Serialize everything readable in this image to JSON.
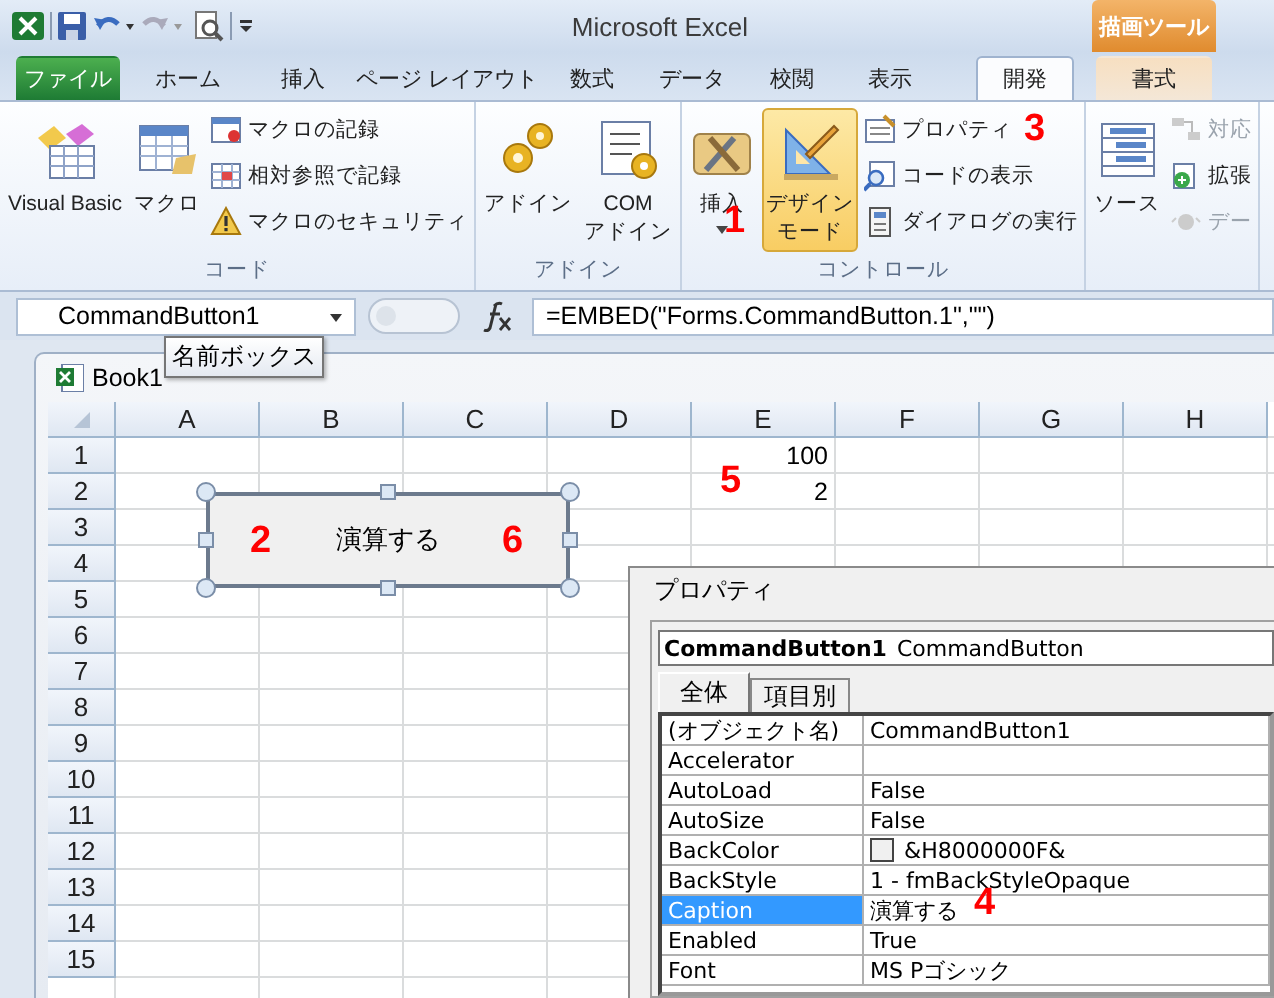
{
  "title_bar": {
    "title": "Microsoft Excel",
    "context_label": "描画ツール"
  },
  "ribbon_tabs": [
    {
      "label": "ファイル",
      "kind": "file",
      "selected": false
    },
    {
      "label": "ホーム",
      "kind": "normal",
      "selected": false
    },
    {
      "label": "挿入",
      "kind": "normal",
      "selected": false
    },
    {
      "label": "ページ レイアウト",
      "kind": "normal",
      "selected": false
    },
    {
      "label": "数式",
      "kind": "normal",
      "selected": false
    },
    {
      "label": "データ",
      "kind": "normal",
      "selected": false
    },
    {
      "label": "校閲",
      "kind": "normal",
      "selected": false
    },
    {
      "label": "表示",
      "kind": "normal",
      "selected": false
    },
    {
      "label": "開発",
      "kind": "normal",
      "selected": true
    },
    {
      "label": "書式",
      "kind": "context",
      "selected": false
    }
  ],
  "ribbon_groups": [
    {
      "label": "コード",
      "large": [
        {
          "lines": [
            "Visual Basic"
          ],
          "selected": false,
          "dropdown": false
        },
        {
          "lines": [
            "マクロ"
          ],
          "selected": false,
          "dropdown": false
        }
      ],
      "small": [
        {
          "label": "マクロの記録",
          "disabled": false
        },
        {
          "label": "相対参照で記録",
          "disabled": false
        },
        {
          "label": "マクロのセキュリティ",
          "disabled": false
        }
      ]
    },
    {
      "label": "アドイン",
      "large": [
        {
          "lines": [
            "アドイン"
          ],
          "selected": false,
          "dropdown": false
        },
        {
          "lines": [
            "COM",
            "アドイン"
          ],
          "selected": false,
          "dropdown": false
        }
      ]
    },
    {
      "label": "コントロール",
      "large": [
        {
          "lines": [
            "挿入"
          ],
          "selected": false,
          "dropdown": true
        },
        {
          "lines": [
            "デザイン",
            "モード"
          ],
          "selected": true,
          "dropdown": false
        }
      ],
      "small": [
        {
          "label": "プロパティ",
          "disabled": false
        },
        {
          "label": "コードの表示",
          "disabled": false
        },
        {
          "label": "ダイアログの実行",
          "disabled": false
        }
      ]
    },
    {
      "large": [
        {
          "lines": [
            "ソース"
          ],
          "selected": false,
          "dropdown": false
        }
      ],
      "small": [
        {
          "label": "対応",
          "disabled": true
        },
        {
          "label": "拡張",
          "disabled": false
        },
        {
          "label": "デー",
          "disabled": true
        }
      ]
    }
  ],
  "formula_bar": {
    "name_box": "CommandButton1",
    "formula": "=EMBED(\"Forms.CommandButton.1\",\"\")"
  },
  "tooltip": {
    "text": "名前ボックス"
  },
  "workbook": {
    "title": "Book1",
    "columns": [
      {
        "label": "A"
      },
      {
        "label": "B"
      },
      {
        "label": "C"
      },
      {
        "label": "D"
      },
      {
        "label": "E",
        "values": [
          "100",
          "2"
        ]
      },
      {
        "label": "F"
      },
      {
        "label": "G"
      },
      {
        "label": "H"
      }
    ],
    "rows": [
      "1",
      "2",
      "3",
      "4",
      "5",
      "6",
      "7",
      "8",
      "9",
      "10",
      "11",
      "12",
      "13",
      "14",
      "15"
    ],
    "command_button": {
      "caption": "演算する",
      "selected": true
    }
  },
  "properties": {
    "title": "プロパティ",
    "object_name": "CommandButton1",
    "object_type": "CommandButton",
    "tabs": [
      {
        "label": "全体",
        "selected": true
      },
      {
        "label": "項目別",
        "selected": false
      }
    ],
    "rows": [
      {
        "name": "(オブジェクト名)",
        "kind": "text",
        "value": "CommandButton1",
        "selected": false
      },
      {
        "name": "Accelerator",
        "kind": "text",
        "selected": false
      },
      {
        "name": "AutoLoad",
        "kind": "text",
        "value": "False",
        "selected": false
      },
      {
        "name": "AutoSize",
        "kind": "text",
        "value": "False",
        "selected": false
      },
      {
        "name": "BackColor",
        "kind": "color",
        "value": "&H8000000F&",
        "selected": false
      },
      {
        "name": "BackStyle",
        "kind": "text",
        "value": "1 - fmBackStyleOpaque",
        "selected": false
      },
      {
        "name": "Caption",
        "kind": "text",
        "value": "演算する",
        "selected": true
      },
      {
        "name": "Enabled",
        "kind": "text",
        "value": "True",
        "selected": false
      },
      {
        "name": "Font",
        "kind": "text",
        "value": "MS Pゴシック",
        "selected": false
      }
    ]
  },
  "annotations": [
    "3",
    "1",
    "5",
    "2",
    "6",
    "4"
  ]
}
